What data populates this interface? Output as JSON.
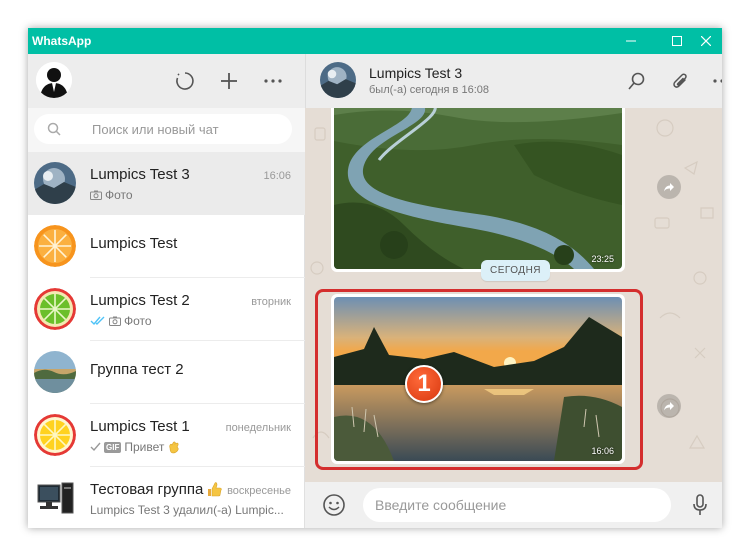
{
  "window": {
    "title": "WhatsApp",
    "accent": "#00bfa5"
  },
  "left_header": {
    "icons": [
      "status-icon",
      "new-chat-icon",
      "menu-icon"
    ]
  },
  "search": {
    "placeholder": "Поиск или новый чат"
  },
  "chats": [
    {
      "name": "Lumpics Test 3",
      "time": "16:06",
      "preview": "Фото",
      "preview_icon": "camera-icon",
      "active": true
    },
    {
      "name": "Lumpics Test",
      "time": "",
      "preview": ""
    },
    {
      "name": "Lumpics Test 2",
      "time": "вторник",
      "preview": "Фото",
      "preview_icon": "camera-icon",
      "ticks": "double-check-blue"
    },
    {
      "name": "Группа тест 2",
      "time": "",
      "preview": ""
    },
    {
      "name": "Lumpics Test 1",
      "time": "понедельник",
      "preview": "Привет",
      "badge": "GIF",
      "ticks": "single-check"
    },
    {
      "name": "Тестовая группа",
      "time": "воскресенье",
      "preview": "Lumpics Test 3 удалил(-а) Lumpic..."
    }
  ],
  "conversation": {
    "contact_name": "Lumpics Test 3",
    "contact_status": "был(-а) сегодня в 16:08",
    "header_icons": [
      "search-icon",
      "attach-icon",
      "menu-icon"
    ],
    "messages": [
      {
        "type": "image",
        "time": "23:25",
        "subject": "river-landscape"
      },
      {
        "type": "day-separator",
        "label": "СЕГОДНЯ"
      },
      {
        "type": "image",
        "time": "16:06",
        "subject": "sunset-lake",
        "highlighted": true
      }
    ],
    "step_marker": "1"
  },
  "composer": {
    "placeholder": "Введите сообщение"
  }
}
